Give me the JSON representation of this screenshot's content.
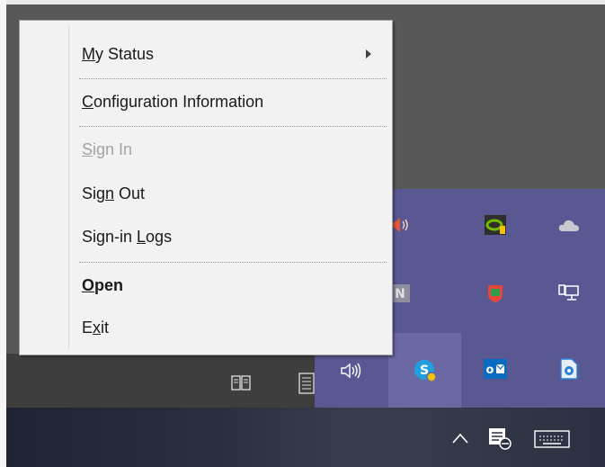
{
  "menu": {
    "items": [
      {
        "pre": "",
        "acc": "M",
        "post": "y Status",
        "enabled": true,
        "bold": false,
        "submenu": true
      },
      {
        "pre": "",
        "acc": "C",
        "post": "onfiguration Information",
        "enabled": true,
        "bold": false,
        "submenu": false
      },
      {
        "pre": "",
        "acc": "S",
        "post": "ign In",
        "enabled": false,
        "bold": false,
        "submenu": false
      },
      {
        "pre": "Sig",
        "acc": "n",
        "post": " Out",
        "enabled": true,
        "bold": false,
        "submenu": false
      },
      {
        "pre": "Sign-in ",
        "acc": "L",
        "post": "ogs",
        "enabled": true,
        "bold": false,
        "submenu": false
      },
      {
        "pre": "",
        "acc": "O",
        "post": "pen",
        "enabled": true,
        "bold": true,
        "submenu": false
      },
      {
        "pre": "E",
        "acc": "x",
        "post": "it",
        "enabled": true,
        "bold": false,
        "submenu": false
      }
    ]
  },
  "tray_icons": [
    {
      "name": "volume-muted-icon",
      "color": "#d04a3a"
    },
    {
      "name": "nvidia-icon",
      "color": "#76b900"
    },
    {
      "name": "onedrive-cloud-icon",
      "color": "#c8c8c8"
    },
    {
      "name": "n-app-icon",
      "color": "#9a9a9a"
    },
    {
      "name": "shield-app-icon",
      "color": "#e8453c"
    },
    {
      "name": "network-icon",
      "color": "#ffffff"
    },
    {
      "name": "speaker-icon",
      "color": "#ffffff"
    },
    {
      "name": "skype-for-business-icon",
      "color": "#1fa0e0"
    },
    {
      "name": "outlook-icon",
      "color": "#0a6cc0"
    },
    {
      "name": "remote-assist-icon",
      "color": "#2b7fd8"
    }
  ],
  "taskbar": {
    "icons": [
      "book-icon",
      "list-icon",
      "chevron-up-icon",
      "notification-icon",
      "keyboard-icon"
    ]
  },
  "colors": {
    "tray_bg": "#595893",
    "menu_bg": "#f2f2f2",
    "disabled_text": "#a3a3a3"
  }
}
